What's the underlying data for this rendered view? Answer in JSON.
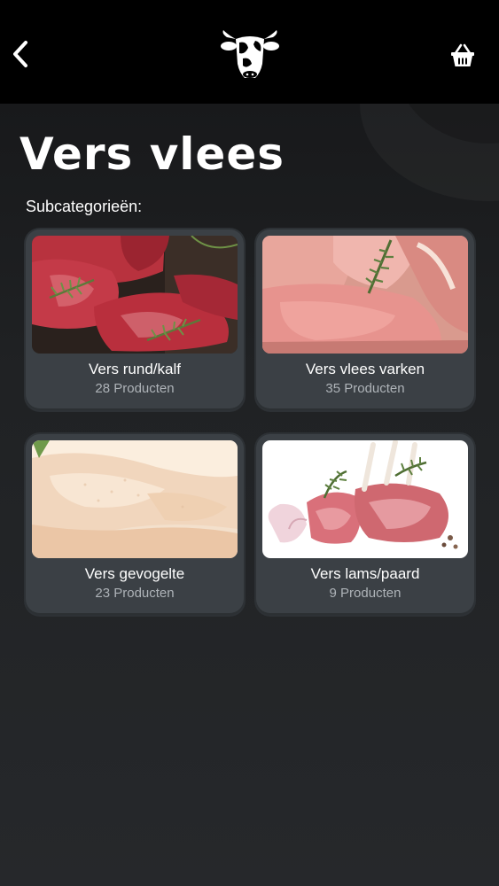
{
  "header": {
    "back_icon": "chevron-left-icon",
    "logo": "cow-logo",
    "basket_icon": "shopping-basket-icon"
  },
  "page": {
    "title": "Vers vlees",
    "subcategories_label": "Subcategorieën:"
  },
  "categories": [
    {
      "name": "Vers rund/kalf",
      "count": "28 Producten",
      "image": "beef-steaks-photo"
    },
    {
      "name": "Vers vlees varken",
      "count": "35 Producten",
      "image": "pork-chops-photo"
    },
    {
      "name": "Vers gevogelte",
      "count": "23 Producten",
      "image": "raw-chicken-photo"
    },
    {
      "name": "Vers lams/paard",
      "count": "9 Producten",
      "image": "lamb-rack-photo"
    }
  ],
  "colors": {
    "topbar": "#000000",
    "background": "#242628",
    "card": "#3b4045",
    "count_text": "#aeb3b8"
  }
}
